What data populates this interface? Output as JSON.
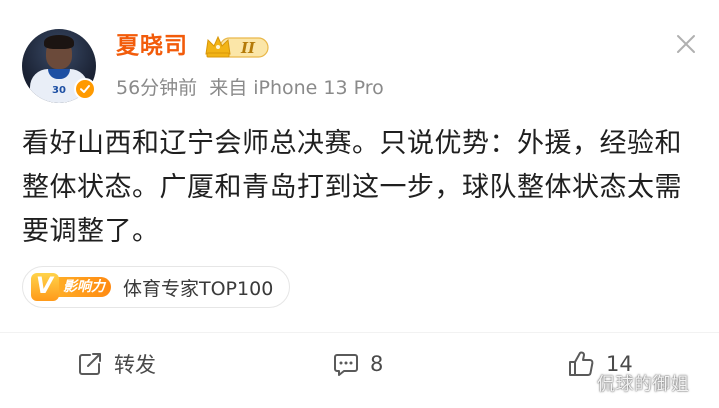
{
  "post": {
    "username": "夏晓司",
    "level_badge": "II",
    "time": "56分钟前",
    "source": "来自 iPhone 13 Pro",
    "text": "看好山西和辽宁会师总决赛。只说优势：外援，经验和整体状态。广厦和青岛打到这一步，球队整体状态太需要调整了。",
    "avatar_jersey_number": "30"
  },
  "influence": {
    "logo_letter": "V",
    "logo_label": "影响力",
    "text": "体育专家TOP100"
  },
  "actions": {
    "repost_label": "转发",
    "comment_count": "8",
    "like_count": "14"
  },
  "watermark": "侃球的御姐",
  "colors": {
    "username": "#f25b0a",
    "accent_orange": "#ff9a00",
    "text": "#1f1f1f",
    "meta": "#8a8a8a"
  },
  "icons": {
    "close": "close-icon",
    "repost": "repost-icon",
    "comment": "comment-icon",
    "like": "thumbs-up-icon",
    "verified": "verified-icon",
    "level": "crown-level-icon"
  }
}
